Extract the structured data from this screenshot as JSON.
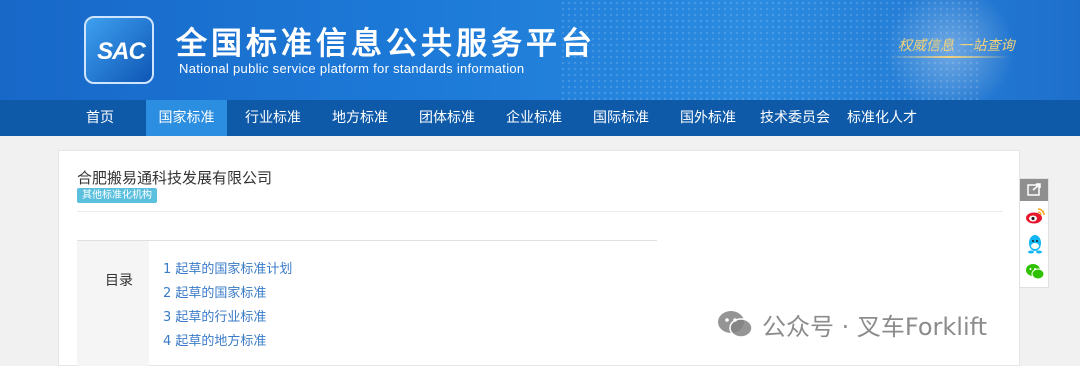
{
  "header": {
    "logo_text": "SAC",
    "title": "全国标准信息公共服务平台",
    "subtitle": "National public service platform  for standards information",
    "slogan": "权威信息 一站查询"
  },
  "nav": {
    "items": [
      {
        "label": "首页",
        "active": false
      },
      {
        "label": "国家标准",
        "active": true
      },
      {
        "label": "行业标准",
        "active": false
      },
      {
        "label": "地方标准",
        "active": false
      },
      {
        "label": "团体标准",
        "active": false
      },
      {
        "label": "企业标准",
        "active": false
      },
      {
        "label": "国际标准",
        "active": false
      },
      {
        "label": "国外标准",
        "active": false
      },
      {
        "label": "技术委员会",
        "active": false
      },
      {
        "label": "标准化人才",
        "active": false
      }
    ]
  },
  "org": {
    "name": "合肥搬易通科技发展有限公司",
    "tag": "其他标准化机构"
  },
  "toc": {
    "label": "目录",
    "items": [
      "1  起草的国家标准计划",
      "2  起草的国家标准",
      "3  起草的行业标准",
      "4  起草的地方标准"
    ]
  },
  "share": {
    "icons": [
      "share-icon",
      "weibo-icon",
      "qq-icon",
      "wechat-icon"
    ]
  },
  "watermark": {
    "text": "公众号 · 叉车Forklift"
  },
  "colors": {
    "banner": "#1d7ad8",
    "nav": "#0e5aa8",
    "nav_active": "#2b8ee0",
    "link": "#3a7bc8",
    "tag": "#5bc0de"
  }
}
